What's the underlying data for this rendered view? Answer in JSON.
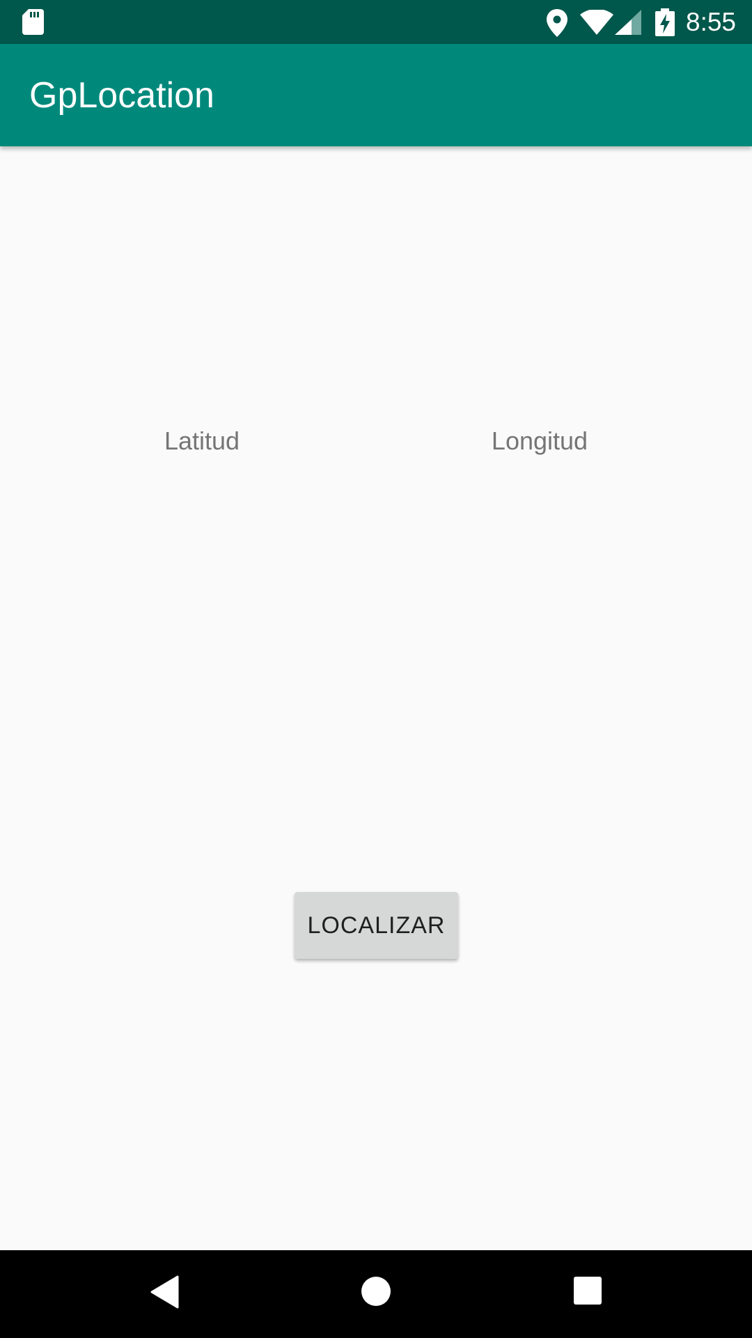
{
  "status_bar": {
    "time": "8:55",
    "icons": [
      "sd-card-icon",
      "location-icon",
      "wifi-icon",
      "signal-icon",
      "battery-charging-icon"
    ],
    "background_color": "#00574b"
  },
  "app_bar": {
    "title": "GpLocation",
    "background_color": "#00897b"
  },
  "main": {
    "latitude_label": "Latitud",
    "longitude_label": "Longitud",
    "locate_button_label": "LOCALIZAR"
  },
  "nav_bar": {
    "icons": [
      "back-icon",
      "home-icon",
      "recents-icon"
    ]
  }
}
